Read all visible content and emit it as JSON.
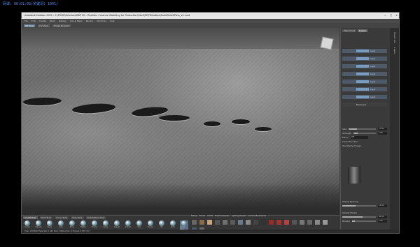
{
  "overlay": {
    "text": "网课: 00:01:02(关键词) 1601/"
  },
  "window": {
    "title": "Autodesk Mudbox 2022 - E:\\PSHM\\Tutorials\\DBP 2D - Realistic Creature Modeling for Production\\Vex2\\Pt\\PtMudbox\\ScaleRelief\\Pass_v4.mud",
    "controls": [
      "—",
      "□",
      "×"
    ]
  },
  "menu": [
    "File",
    "Edit",
    "Create",
    "Mesh",
    "Display",
    "UVs & Maps",
    "Render",
    "Windows",
    "Help"
  ],
  "toolbar": {
    "tabs": [
      "3D View",
      "UV View",
      "Image Browser"
    ],
    "active": "3D View"
  },
  "panel": {
    "tabs": [
      "Object List",
      "Layers"
    ],
    "active": "Layers",
    "layers": [
      "Layer",
      "Layer",
      "Layer",
      "Layer",
      "Layer",
      "Layer",
      "Layer",
      "Layer"
    ],
    "base_label": "Base Layer",
    "props": [
      {
        "label": "Size",
        "value": "17.00",
        "fill": 0.3
      },
      {
        "label": "Strength",
        "value": "2.00",
        "fill": 0.2
      },
      {
        "label": "Mirror",
        "value": "Off",
        "fill": 0.0
      },
      {
        "label": "Invert Function",
        "value": "",
        "fill": 0.0
      },
      {
        "label": "Use Stamp Image",
        "value": "",
        "fill": 0.0
      }
    ],
    "stamp_spacing": {
      "label": "Stamp Spacing",
      "value": "13.00"
    },
    "steady_stroke": {
      "label": "Steady Stroke",
      "value": "60.00"
    },
    "buildup": {
      "label": "Buildup",
      "value": "1.00"
    }
  },
  "right_strip": [
    "Object List",
    "Layers"
  ],
  "bottom": {
    "tool_tabs": [
      "Sculpt Tools",
      "Paint Tools",
      "Curve Tools",
      "Pose Tools",
      "Select/Move Tools"
    ],
    "active_tab": "Sculpt Tools",
    "tools": [
      "Sculpt",
      "Smooth",
      "Relax",
      "Grab",
      "Pinch",
      "Flatten",
      "Foamy",
      "Spray",
      "Repeat",
      "Imprint",
      "Wax",
      "Scrape",
      "Fill",
      "Knife",
      "Smear",
      "Bulge",
      "Amplify",
      "Freeze",
      "Mask",
      "Erase",
      "Sculpt Layer"
    ],
    "active_tool": "Sculpt Layer",
    "stamp_tabs": [
      "Stamp",
      "Stencil",
      "Falloff",
      "Material Presets",
      "Lighting Presets",
      "Camera Bookmarks"
    ],
    "stamp_active": "Stencil"
  },
  "status": "Total: 19798432  Selected: 0  GPU Mem: 3686  Active: 6  Highest: 6  FPS: 53.7"
}
